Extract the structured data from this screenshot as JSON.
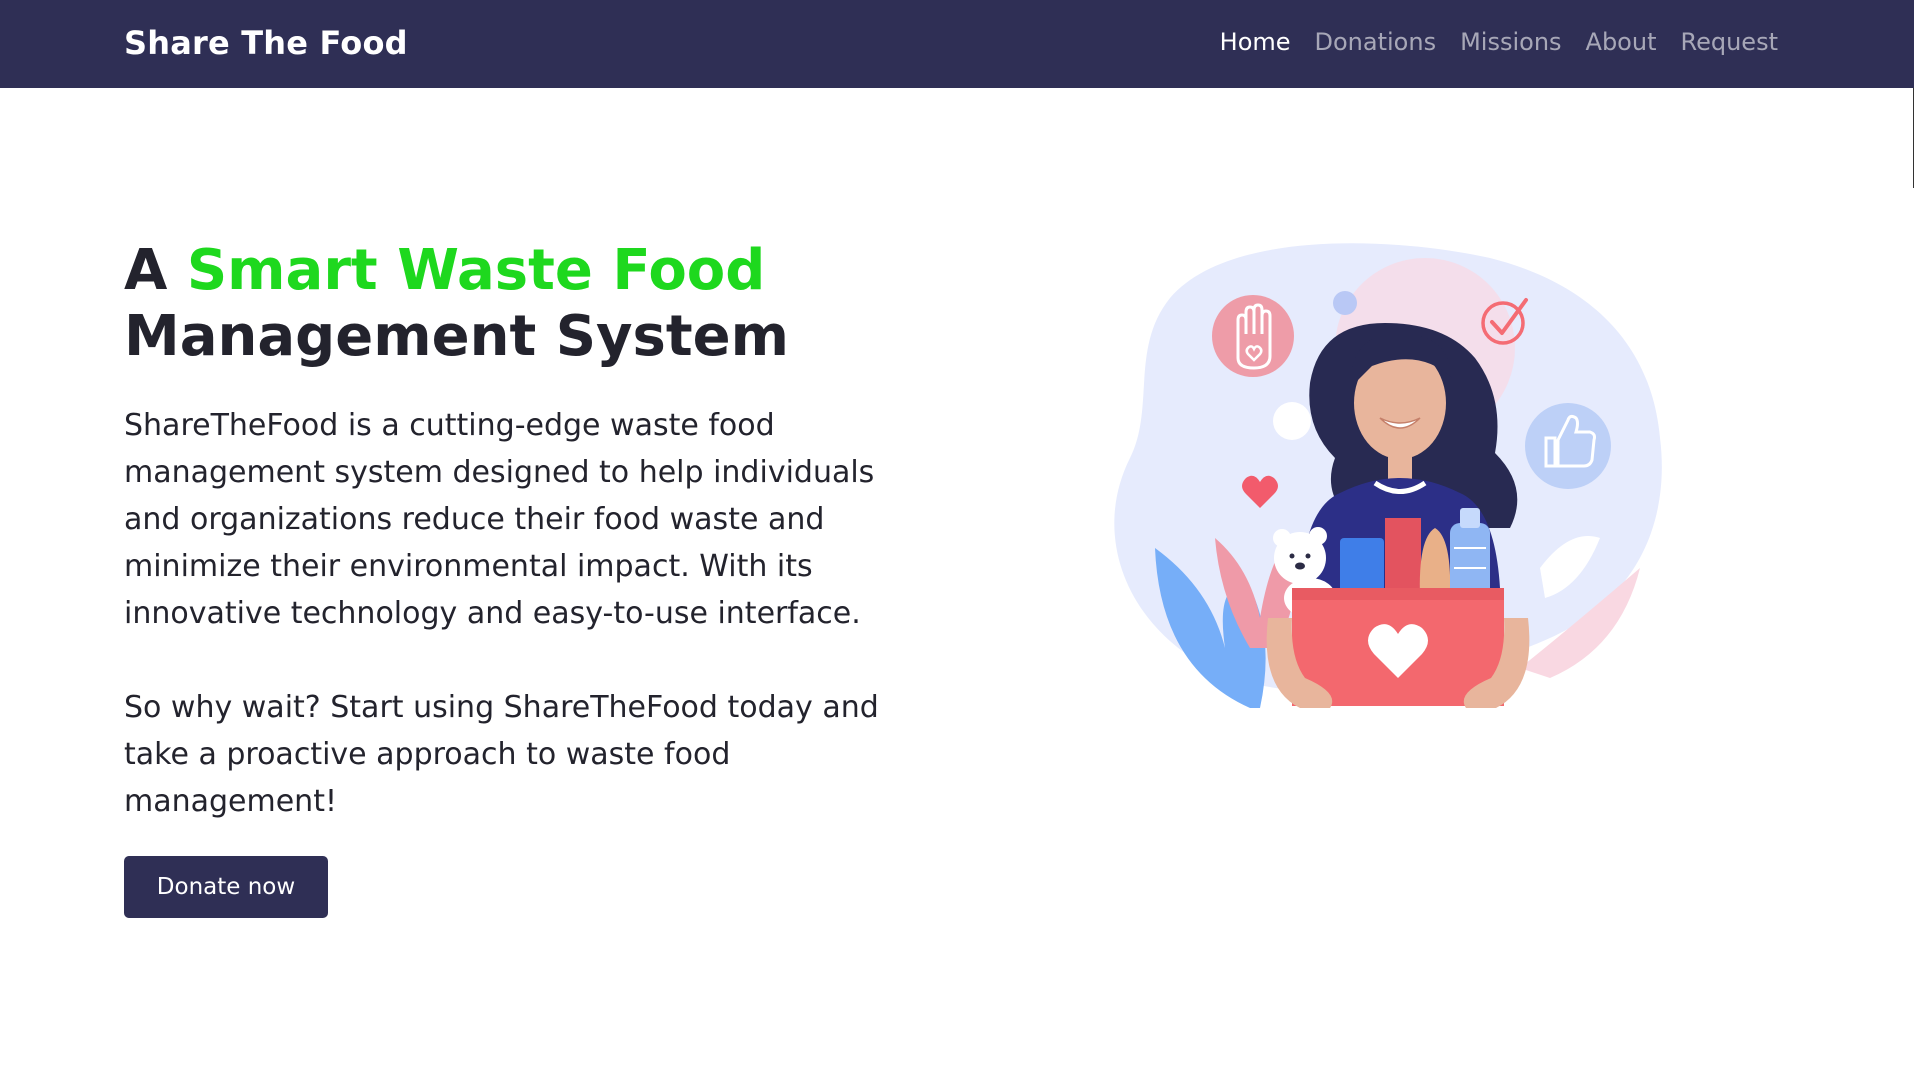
{
  "nav": {
    "brand": "Share The Food",
    "links": [
      {
        "label": "Home",
        "active": true
      },
      {
        "label": "Donations",
        "active": false
      },
      {
        "label": "Missions",
        "active": false
      },
      {
        "label": "About",
        "active": false
      },
      {
        "label": "Request",
        "active": false
      }
    ]
  },
  "hero": {
    "headline_prefix": "A",
    "headline_accent": "Smart Waste Food",
    "headline_suffix": "Management System",
    "paragraph_1": "ShareTheFood is a cutting-edge waste food management system designed to help individuals and organizations reduce their food waste and minimize their environmental impact. With its innovative technology and easy-to-use interface.",
    "paragraph_2": "So why wait? Start using ShareTheFood today and take a proactive approach to waste food management!",
    "cta_label": "Donate now"
  },
  "colors": {
    "navbar": "#2f2f55",
    "accent": "#1ed81e",
    "button": "#2f2f55"
  },
  "illustration": {
    "icons": [
      "hand-heart-icon",
      "checkmark-icon",
      "thumbs-up-icon",
      "heart-icon",
      "heart-box-icon"
    ]
  }
}
